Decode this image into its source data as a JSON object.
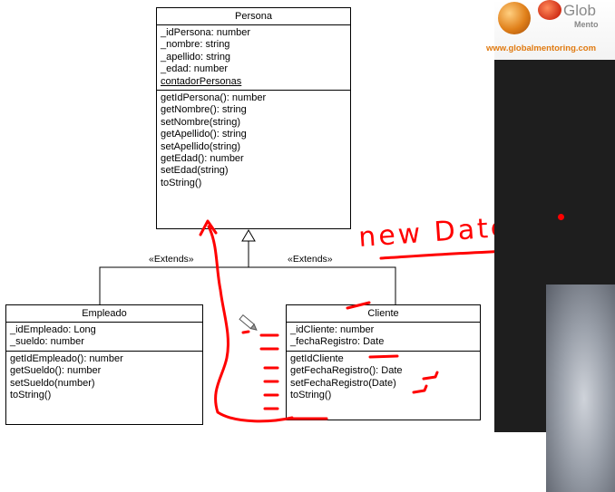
{
  "classes": {
    "persona": {
      "name": "Persona",
      "attributes": [
        "_idPersona: number",
        "_nombre: string",
        "_apellido: string",
        "_edad: number"
      ],
      "static_attribute": "contadorPersonas",
      "methods": [
        "getIdPersona(): number",
        "getNombre(): string",
        "setNombre(string)",
        "getApellido(): string",
        "setApellido(string)",
        "getEdad(): number",
        "setEdad(string)",
        "toString()"
      ]
    },
    "empleado": {
      "name": "Empleado",
      "attributes": [
        "_idEmpleado: Long",
        "_sueldo: number"
      ],
      "methods": [
        "getIdEmpleado(): number",
        "getSueldo(): number",
        "setSueldo(number)",
        "toString()"
      ]
    },
    "cliente": {
      "name": "Cliente",
      "attributes": [
        "_idCliente: number",
        "_fechaRegistro: Date"
      ],
      "methods": [
        "getIdCliente",
        "getFechaRegistro(): Date",
        "setFechaRegistro(Date)",
        "toString()"
      ]
    }
  },
  "relations": {
    "left_label": "«Extends»",
    "right_label": "«Extends»"
  },
  "annotation": {
    "text": "new Date();",
    "color": "#ff0000"
  },
  "sidebar": {
    "brand": "Glob",
    "brand_sub": "Mento",
    "url": "www.globalmentoring.com"
  },
  "colors": {
    "ink": "#ff0000",
    "sidebar_background": "#1f1f1f",
    "url_orange": "#e07a10"
  }
}
